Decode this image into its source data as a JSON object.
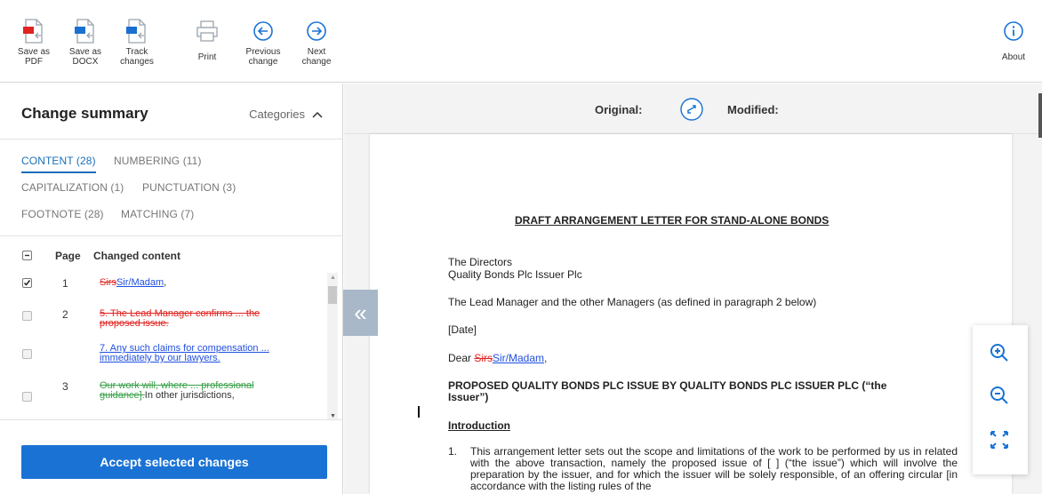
{
  "toolbar": {
    "buttons": [
      {
        "name": "save-pdf",
        "label": "Save as\nPDF",
        "icon": "pdf-file-icon"
      },
      {
        "name": "save-docx",
        "label": "Save as\nDOCX",
        "icon": "docx-file-icon"
      },
      {
        "name": "track-changes",
        "label": "Track\nchanges",
        "icon": "track-changes-file-icon"
      },
      {
        "name": "print",
        "label": "Print",
        "icon": "printer-icon"
      },
      {
        "name": "previous-change",
        "label": "Previous\nchange",
        "icon": "arrow-left-circle-icon"
      },
      {
        "name": "next-change",
        "label": "Next\nchange",
        "icon": "arrow-right-circle-icon"
      }
    ],
    "about_label": "About"
  },
  "summary": {
    "title": "Change summary",
    "categories_label": "Categories",
    "categories": [
      {
        "label": "CONTENT",
        "count": "(28)",
        "active": true
      },
      {
        "label": "NUMBERING",
        "count": "(11)",
        "active": false
      },
      {
        "label": "CAPITALIZATION",
        "count": "(1)",
        "active": false
      },
      {
        "label": "PUNCTUATION",
        "count": "(3)",
        "active": false
      },
      {
        "label": "FOOTNOTE",
        "count": "(28)",
        "active": false
      },
      {
        "label": "MATCHING",
        "count": "(7)",
        "active": false
      }
    ],
    "list_headers": {
      "page": "Page",
      "content": "Changed content"
    },
    "rows": [
      {
        "page": "1",
        "checked": true,
        "del": "Sirs",
        "ins": "Sir/Madam",
        "tail": ","
      },
      {
        "page": "2",
        "checked": false,
        "del_line1": "5. The Lead Manager confirms ... the",
        "del_line2": "proposed issue."
      },
      {
        "page": "",
        "checked": false,
        "ins_line1": "7. Any such claims for compensation ...",
        "ins_line2": "immediately by our lawyers."
      },
      {
        "page": "3",
        "checked": false,
        "del_line1": "Our work will, where ... professional",
        "del_line2": "guidance].",
        "plain_tail": "In other jurisdictions,"
      }
    ],
    "accept_label": "Accept selected changes"
  },
  "compare": {
    "original_label": "Original:",
    "modified_label": "Modified:"
  },
  "document": {
    "title": "DRAFT ARRANGEMENT LETTER FOR STAND-ALONE BONDS",
    "addressee_line1": "The Directors",
    "addressee_line2": "Quality Bonds Plc Issuer Plc",
    "lead_manager": "The Lead Manager and the other Managers (as defined in paragraph 2 below)",
    "date": "[Date]",
    "dear": "Dear ",
    "dear_del": "Sirs",
    "dear_ins": "Sir/Madam",
    "dear_tail": ",",
    "proposed_line1": "PROPOSED QUALITY BONDS PLC ISSUE BY QUALITY BONDS PLC ISSUER PLC (“the",
    "proposed_line2": "Issuer”)",
    "intro": "Introduction",
    "para_num": "1.",
    "para_text": "This arrangement letter sets out the scope and limitations of the work to be performed by us in related with the above transaction, namely the proposed issue of [ ] (“the issue”) which will involve the preparation by the issuer, and for which the issuer will be solely responsible, of an offering circular [in accordance with the listing rules of the"
  },
  "colors": {
    "accent": "#1a73d4",
    "deleted_red": "#e0231f",
    "inserted_blue": "#1f4fe0",
    "deleted_green": "#3aa04a"
  }
}
